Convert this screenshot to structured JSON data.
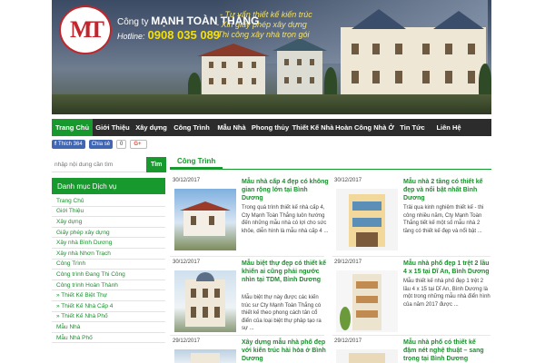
{
  "banner": {
    "logo_text": "MT",
    "company_prefix": "Công ty",
    "company_name": "MẠNH TOÀN THẮNG",
    "hotline_label": "Hotline:",
    "hotline_number": "0908 035 089",
    "slogans": [
      "- Tư vấn thiết kế kiến trúc",
      "- Xin giấy phép xây dựng",
      "- Thi công xây nhà trọn gói"
    ]
  },
  "nav": {
    "items": [
      "Trang Chủ",
      "Giới Thiệu",
      "Xây dựng",
      "Công Trình",
      "Mẫu Nhà",
      "Phong thủy",
      "Thiết Kế Nhà",
      "Hoàn Công Nhà Ở",
      "Tin Tức",
      "Liên Hệ"
    ],
    "active_index": 0
  },
  "social": {
    "facebook_like": "Thích 364",
    "share": "Chia sẻ",
    "gplus_count": "0",
    "gplus_label": "G+"
  },
  "search": {
    "placeholder": "nhập nội dung cần tìm",
    "button": "Tìm"
  },
  "sidebar": {
    "title": "Danh mục Dịch vụ",
    "items": [
      "Trang Chủ",
      "Giới Thiệu",
      "Xây dựng",
      "Giấy phép xây dựng",
      "Xây nhà Bình Dương",
      "Xây nhà Nhơn Trạch",
      "Công Trình",
      "Công trình Đang Thi Công",
      "Công trình Hoàn Thành",
      "» Thiết Kế Biệt Thự",
      "» Thiết Kế Nhà Cấp 4",
      "» Thiết Kế Nhà Phố",
      "Mẫu Nhà",
      "Mẫu Nhà Phố"
    ]
  },
  "main": {
    "tab": "Công Trình",
    "cards": [
      {
        "date": "30/12/2017",
        "title": "Mẫu nhà cấp 4 đẹp có không gian rộng lớn tại Bình Dương",
        "desc": "Trong quá trình thiết kế nhà cấp 4, Cty Mạnh Toàn Thắng luôn hướng đến những mẫu nhà có lợi cho sức khỏe, diễn hình là mẫu nhà cấp 4 ..."
      },
      {
        "date": "30/12/2017",
        "title": "Mẫu nhà 2 tầng có thiết kế đẹp và nổi bật nhất Bình Dương",
        "desc": "Trải qua kinh nghiệm thiết kế - thi công nhiều năm, Cty Mạnh Toàn Thắng tiết kế một số mẫu nhà 2 tầng có thiết kế đẹp và nổi bật ..."
      },
      {
        "date": "30/12/2017",
        "title": "Mẫu biệt thự đẹp có thiết kế khiến ai cũng phải ngước nhìn tại TDM, Bình Dương",
        "desc": "Mẫu biệt thự này được các kiến trúc sư Cty Mạnh Toàn Thắng có thiết kế theo phong cách tân cổ điển của loại biệt thự phâp tạo ra sự ..."
      },
      {
        "date": "29/12/2017",
        "title": "Mẫu nhà phố đẹp 1 trệt 2 lầu 4 x 15 tại Dĩ An, Bình Dương",
        "desc": "Mẫu thiết kế nhà phố đẹp 1 trệt 2 lầu 4 x 15 tại Dĩ An, Bình Dương là một trong những mẫu nhà điển hình của năm 2017 được ..."
      },
      {
        "date": "29/12/2017",
        "title": "Xây dựng mẫu nhà phố đẹp với kiến trúc hài hòa ở Bình Dương",
        "desc": ""
      },
      {
        "date": "29/12/2017",
        "title": "Mẫu nhà phố có thiết kế đậm nét nghệ thuật – sang trọng tại Bình Dương",
        "desc": ""
      }
    ]
  },
  "colors": {
    "brand_green": "#18992d",
    "nav_bg": "#2c2c2c",
    "link_green": "#1b8f2e"
  }
}
